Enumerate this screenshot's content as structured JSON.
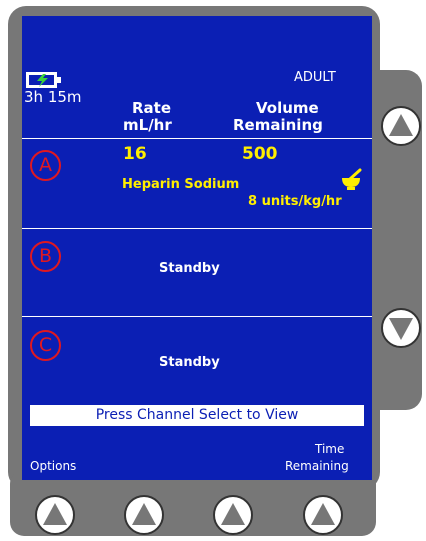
{
  "status": {
    "battery_time": "3h 15m",
    "mode": "ADULT"
  },
  "header": {
    "rate_line1": "Rate",
    "rate_line2": "mL/hr",
    "volume_line1": "Volume",
    "volume_line2": "Remaining"
  },
  "channels": [
    {
      "letter": "A",
      "rate": "16",
      "volume": "500",
      "drug": "Heparin Sodium",
      "dose": "8 units/kg/hr"
    },
    {
      "letter": "B",
      "status": "Standby"
    },
    {
      "letter": "C",
      "status": "Standby"
    }
  ],
  "prompt": "Press Channel Select to View",
  "softkeys": {
    "left": "Options",
    "right_line1": "Time",
    "right_line2": "Remaining"
  },
  "colors": {
    "screen_bg": "#0b1fb4",
    "text": "#ffffff",
    "value_yellow": "#ffee00",
    "channel_red": "#e01820",
    "bezel": "#777777"
  }
}
